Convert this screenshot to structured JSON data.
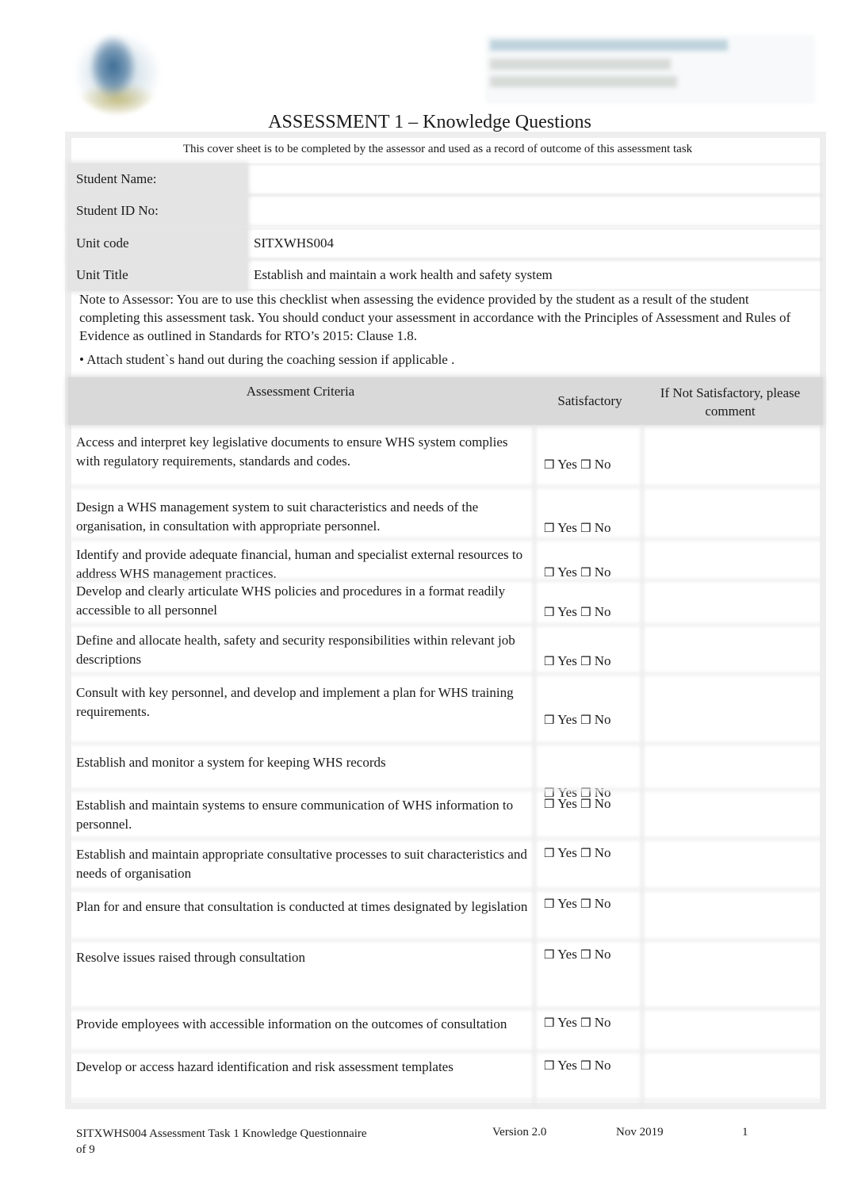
{
  "logo": {
    "icon": "institution-logo"
  },
  "header": {
    "institution_text": [
      "blurred institution name",
      "blurred address line",
      "blurred contact line"
    ]
  },
  "document": {
    "title": "ASSESSMENT 1 – Knowledge Questions",
    "cover_note": "This cover sheet is to be completed by the assessor and used as a record of outcome of this assessment task"
  },
  "info": {
    "student_name_label": "Student Name:",
    "student_name_value": "",
    "student_id_label": "Student ID No:",
    "student_id_value": "",
    "unit_code_label": "Unit code",
    "unit_code_value": "SITXWHS004",
    "unit_title_label": "Unit Title",
    "unit_title_value": "Establish and maintain a work health and safety system"
  },
  "note": {
    "text": "Note to Assessor:  You are to use this checklist when assessing the evidence provided by the student as a result of the student completing this assessment task. You should conduct your assessment in accordance with the Principles of Assessment and Rules of Evidence as outlined in Standards for RTO’s 2015: Clause 1.8.",
    "bullet": "• Attach student`s hand out during the coaching session if applicable  ."
  },
  "criteria_table": {
    "headers": {
      "criteria": "Assessment Criteria",
      "satisfactory": "Satisfactory",
      "comment": "If Not Satisfactory, please comment"
    },
    "checkbox_glyph": "❒",
    "yes_label": "Yes",
    "no_label": "No",
    "rows": [
      {
        "text": "Access and interpret key legislative documents to ensure WHS system complies with regulatory requirements, standards and codes.",
        "yes": false,
        "no": false,
        "comment": ""
      },
      {
        "text": "Design a WHS management system to suit characteristics and needs of the organisation, in consultation with appropriate personnel.",
        "yes": false,
        "no": false,
        "comment": ""
      },
      {
        "text": "Identify and provide adequate financial, human and specialist external resources to address WHS management practices.",
        "yes": false,
        "no": false,
        "comment": ""
      },
      {
        "text": "Develop and clearly articulate WHS policies and procedures in a format readily accessible to all personnel",
        "yes": false,
        "no": false,
        "comment": ""
      },
      {
        "text": "Define and allocate health, safety and security responsibilities within relevant job descriptions",
        "yes": false,
        "no": false,
        "comment": ""
      },
      {
        "text": "Consult with key personnel, and develop and implement a plan for WHS training requirements.",
        "yes": false,
        "no": false,
        "comment": ""
      },
      {
        "text": "Establish and monitor a system for keeping WHS records",
        "yes": false,
        "no": false,
        "comment": ""
      },
      {
        "text": "Establish and maintain systems to ensure communication of WHS information to personnel.",
        "yes": false,
        "no": false,
        "comment": ""
      },
      {
        "text": "Establish and maintain appropriate consultative processes to suit characteristics and needs of organisation",
        "yes": false,
        "no": false,
        "comment": ""
      },
      {
        "text": "Plan for and ensure that consultation is conducted at times designated by legislation",
        "yes": false,
        "no": false,
        "comment": ""
      },
      {
        "text": "Resolve issues raised through consultation",
        "yes": false,
        "no": false,
        "comment": ""
      },
      {
        "text": "Provide employees with accessible information on the outcomes of consultation",
        "yes": false,
        "no": false,
        "comment": ""
      },
      {
        "text": "Develop or access hazard identification and risk assessment templates",
        "yes": false,
        "no": false,
        "comment": ""
      }
    ]
  },
  "footer": {
    "doc_name": "SITXWHS004 Assessment Task 1 Knowledge Questionnaire",
    "page_of": "of  9",
    "version": "Version 2.0",
    "date": "Nov 2019",
    "page_number": "1"
  }
}
